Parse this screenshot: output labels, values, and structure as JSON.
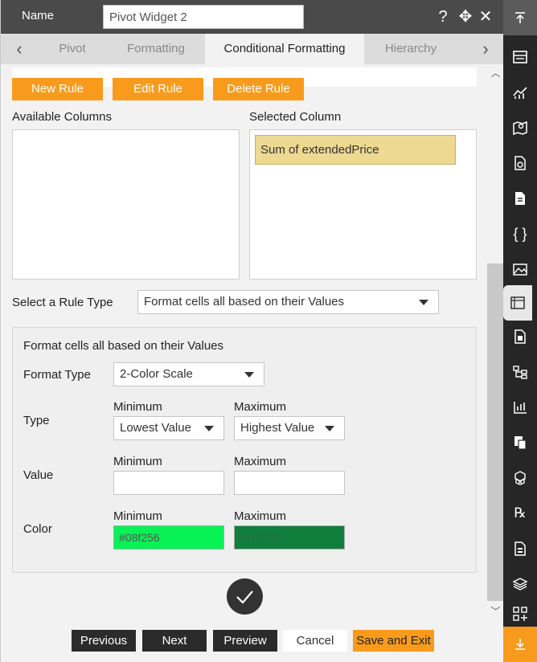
{
  "header": {
    "name_label": "Name",
    "name_value": "Pivot Widget 2",
    "help_icon": "?",
    "move_icon": "✥",
    "close_icon": "✕"
  },
  "tabs": [
    {
      "label": "Pivot"
    },
    {
      "label": "Formatting"
    },
    {
      "label": "Conditional Formatting"
    },
    {
      "label": "Hierarchy"
    }
  ],
  "rules": {
    "new_label": "New Rule",
    "edit_label": "Edit Rule",
    "delete_label": "Delete Rule"
  },
  "columns": {
    "available_label": "Available Columns",
    "selected_label": "Selected Column",
    "selected_item": "Sum of extendedPrice"
  },
  "rule_type": {
    "label": "Select a Rule Type",
    "value": "Format cells all based on their Values"
  },
  "format_box": {
    "title": "Format cells all based on their Values",
    "format_type_label": "Format Type",
    "format_type_value": "2-Color Scale",
    "type_label": "Type",
    "value_label": "Value",
    "color_label": "Color",
    "min_label": "Minimum",
    "max_label": "Maximum",
    "type_min_value": "Lowest Value",
    "type_max_value": "Highest Value",
    "color_min_value": "#08f256",
    "color_max_value": "#107f3d"
  },
  "footer": {
    "previous_label": "Previous",
    "next_label": "Next",
    "preview_label": "Preview",
    "cancel_label": "Cancel",
    "save_exit_label": "Save and Exit"
  },
  "colors": {
    "accent": "#f89b1c",
    "header_bg": "#4a4a4a",
    "sidebar_bg": "#262626",
    "selected_item_bg": "#eed993",
    "color_min": "#08f256",
    "color_max": "#107f3d"
  },
  "sidebar_icons": [
    "collapse-up-icon",
    "table-icon",
    "chart-icon",
    "map-icon",
    "report-icon",
    "document-icon",
    "json-icon",
    "image-icon",
    "pivot-icon",
    "calculator-icon",
    "tree-icon",
    "kpi-icon",
    "copy-icon",
    "cube-icon",
    "rx-icon",
    "list-icon",
    "layers-icon",
    "grid-add-icon",
    "download-icon"
  ]
}
